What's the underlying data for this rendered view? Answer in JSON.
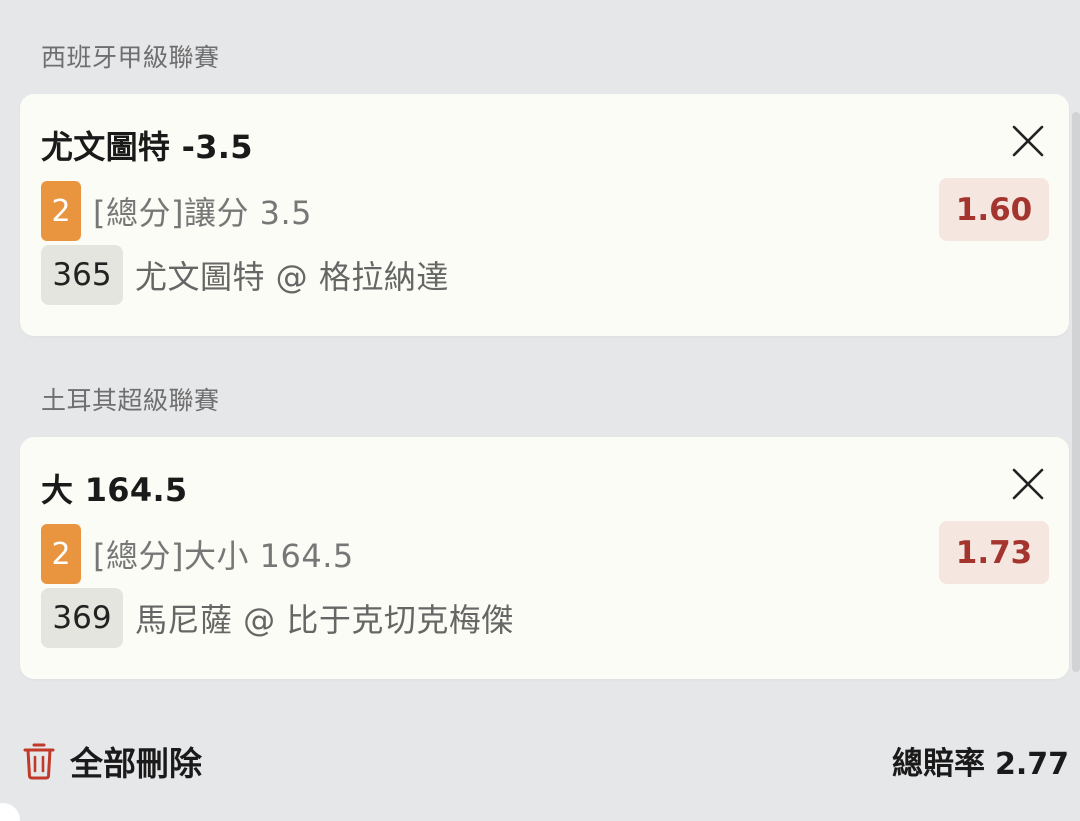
{
  "bets": [
    {
      "league": "西班牙甲級聯賽",
      "selection": "尤文圖特 -3.5",
      "count": "2",
      "market": "[總分]讓分 3.5",
      "odds": "1.60",
      "match_id": "365",
      "match": "尤文圖特 @ 格拉納達"
    },
    {
      "league": "土耳其超級聯賽",
      "selection": "大 164.5",
      "count": "2",
      "market": "[總分]大小 164.5",
      "odds": "1.73",
      "match_id": "369",
      "match": "馬尼薩 @ 比于克切克梅傑"
    }
  ],
  "footer": {
    "delete_all_label": "全部刪除",
    "total_odds_label": "總賠率",
    "total_odds_value": "2.77"
  },
  "icons": {
    "close": "close-icon",
    "delete": "trash-icon"
  },
  "colors": {
    "badge": "#e9953f",
    "odds_text": "#a4342e",
    "odds_bg": "#f5e6e0",
    "trash": "#c0392b"
  }
}
